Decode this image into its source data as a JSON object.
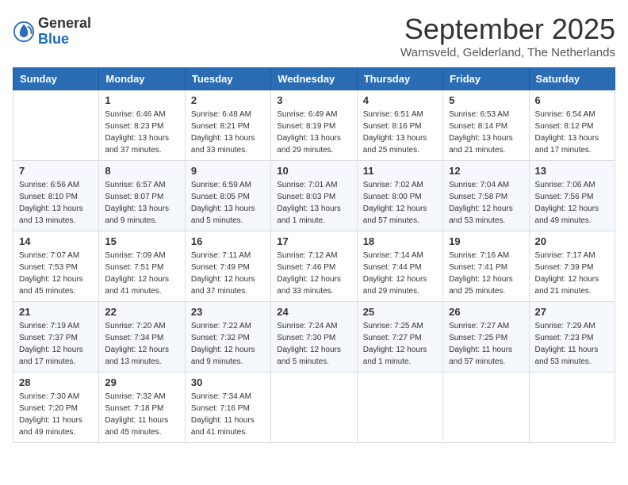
{
  "header": {
    "logo_general": "General",
    "logo_blue": "Blue",
    "month_title": "September 2025",
    "location": "Warnsveld, Gelderland, The Netherlands"
  },
  "days_of_week": [
    "Sunday",
    "Monday",
    "Tuesday",
    "Wednesday",
    "Thursday",
    "Friday",
    "Saturday"
  ],
  "weeks": [
    [
      {
        "num": "",
        "info": ""
      },
      {
        "num": "1",
        "info": "Sunrise: 6:46 AM\nSunset: 8:23 PM\nDaylight: 13 hours\nand 37 minutes."
      },
      {
        "num": "2",
        "info": "Sunrise: 6:48 AM\nSunset: 8:21 PM\nDaylight: 13 hours\nand 33 minutes."
      },
      {
        "num": "3",
        "info": "Sunrise: 6:49 AM\nSunset: 8:19 PM\nDaylight: 13 hours\nand 29 minutes."
      },
      {
        "num": "4",
        "info": "Sunrise: 6:51 AM\nSunset: 8:16 PM\nDaylight: 13 hours\nand 25 minutes."
      },
      {
        "num": "5",
        "info": "Sunrise: 6:53 AM\nSunset: 8:14 PM\nDaylight: 13 hours\nand 21 minutes."
      },
      {
        "num": "6",
        "info": "Sunrise: 6:54 AM\nSunset: 8:12 PM\nDaylight: 13 hours\nand 17 minutes."
      }
    ],
    [
      {
        "num": "7",
        "info": "Sunrise: 6:56 AM\nSunset: 8:10 PM\nDaylight: 13 hours\nand 13 minutes."
      },
      {
        "num": "8",
        "info": "Sunrise: 6:57 AM\nSunset: 8:07 PM\nDaylight: 13 hours\nand 9 minutes."
      },
      {
        "num": "9",
        "info": "Sunrise: 6:59 AM\nSunset: 8:05 PM\nDaylight: 13 hours\nand 5 minutes."
      },
      {
        "num": "10",
        "info": "Sunrise: 7:01 AM\nSunset: 8:03 PM\nDaylight: 13 hours\nand 1 minute."
      },
      {
        "num": "11",
        "info": "Sunrise: 7:02 AM\nSunset: 8:00 PM\nDaylight: 12 hours\nand 57 minutes."
      },
      {
        "num": "12",
        "info": "Sunrise: 7:04 AM\nSunset: 7:58 PM\nDaylight: 12 hours\nand 53 minutes."
      },
      {
        "num": "13",
        "info": "Sunrise: 7:06 AM\nSunset: 7:56 PM\nDaylight: 12 hours\nand 49 minutes."
      }
    ],
    [
      {
        "num": "14",
        "info": "Sunrise: 7:07 AM\nSunset: 7:53 PM\nDaylight: 12 hours\nand 45 minutes."
      },
      {
        "num": "15",
        "info": "Sunrise: 7:09 AM\nSunset: 7:51 PM\nDaylight: 12 hours\nand 41 minutes."
      },
      {
        "num": "16",
        "info": "Sunrise: 7:11 AM\nSunset: 7:49 PM\nDaylight: 12 hours\nand 37 minutes."
      },
      {
        "num": "17",
        "info": "Sunrise: 7:12 AM\nSunset: 7:46 PM\nDaylight: 12 hours\nand 33 minutes."
      },
      {
        "num": "18",
        "info": "Sunrise: 7:14 AM\nSunset: 7:44 PM\nDaylight: 12 hours\nand 29 minutes."
      },
      {
        "num": "19",
        "info": "Sunrise: 7:16 AM\nSunset: 7:41 PM\nDaylight: 12 hours\nand 25 minutes."
      },
      {
        "num": "20",
        "info": "Sunrise: 7:17 AM\nSunset: 7:39 PM\nDaylight: 12 hours\nand 21 minutes."
      }
    ],
    [
      {
        "num": "21",
        "info": "Sunrise: 7:19 AM\nSunset: 7:37 PM\nDaylight: 12 hours\nand 17 minutes."
      },
      {
        "num": "22",
        "info": "Sunrise: 7:20 AM\nSunset: 7:34 PM\nDaylight: 12 hours\nand 13 minutes."
      },
      {
        "num": "23",
        "info": "Sunrise: 7:22 AM\nSunset: 7:32 PM\nDaylight: 12 hours\nand 9 minutes."
      },
      {
        "num": "24",
        "info": "Sunrise: 7:24 AM\nSunset: 7:30 PM\nDaylight: 12 hours\nand 5 minutes."
      },
      {
        "num": "25",
        "info": "Sunrise: 7:25 AM\nSunset: 7:27 PM\nDaylight: 12 hours\nand 1 minute."
      },
      {
        "num": "26",
        "info": "Sunrise: 7:27 AM\nSunset: 7:25 PM\nDaylight: 11 hours\nand 57 minutes."
      },
      {
        "num": "27",
        "info": "Sunrise: 7:29 AM\nSunset: 7:23 PM\nDaylight: 11 hours\nand 53 minutes."
      }
    ],
    [
      {
        "num": "28",
        "info": "Sunrise: 7:30 AM\nSunset: 7:20 PM\nDaylight: 11 hours\nand 49 minutes."
      },
      {
        "num": "29",
        "info": "Sunrise: 7:32 AM\nSunset: 7:18 PM\nDaylight: 11 hours\nand 45 minutes."
      },
      {
        "num": "30",
        "info": "Sunrise: 7:34 AM\nSunset: 7:16 PM\nDaylight: 11 hours\nand 41 minutes."
      },
      {
        "num": "",
        "info": ""
      },
      {
        "num": "",
        "info": ""
      },
      {
        "num": "",
        "info": ""
      },
      {
        "num": "",
        "info": ""
      }
    ]
  ]
}
